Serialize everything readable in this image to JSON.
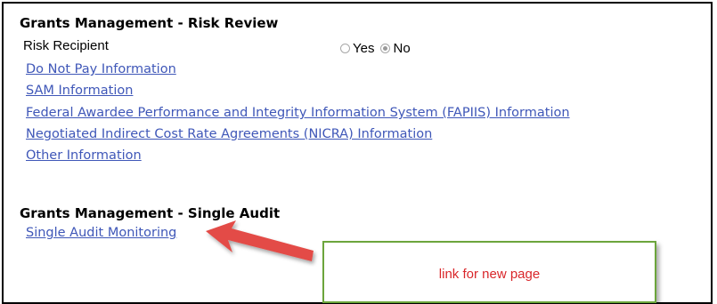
{
  "risk_review": {
    "title": "Grants Management - Risk Review",
    "risk_recipient_label": "Risk Recipient",
    "options": {
      "yes": "Yes",
      "no": "No"
    },
    "selected": "No",
    "links": [
      "Do Not Pay Information",
      "SAM Information",
      "Federal Awardee Performance and Integrity Information System (FAPIIS) Information",
      "Negotiated Indirect Cost Rate Agreements (NICRA) Information",
      "Other Information"
    ]
  },
  "single_audit": {
    "title": "Grants Management - Single Audit",
    "link": "Single Audit Monitoring"
  },
  "annotation": {
    "text": "link for new page",
    "arrow_color": "#e34c46",
    "box_border_color": "#6ca53c",
    "text_color": "#d9262a"
  },
  "colors": {
    "link": "#3f57b8"
  }
}
